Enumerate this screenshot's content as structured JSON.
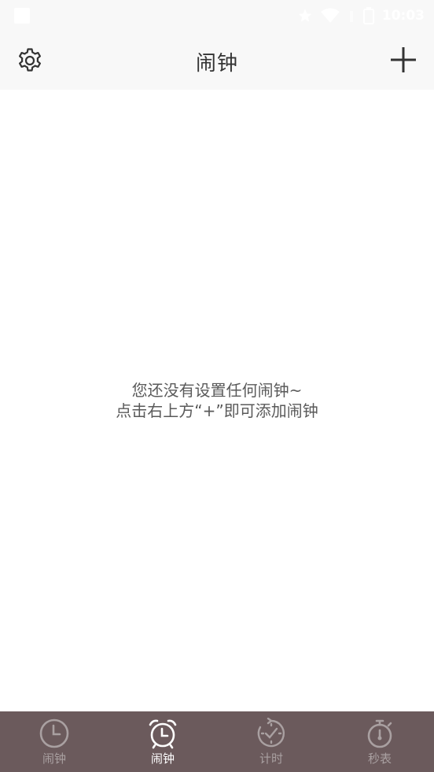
{
  "status_bar": {
    "time": "10:03"
  },
  "header": {
    "title": "闹钟"
  },
  "empty_state": {
    "line1": "您还没有设置任何闹钟~",
    "line2": "点击右上方“+”即可添加闹钟"
  },
  "bottom_nav": {
    "items": [
      {
        "label": "闹钟",
        "icon": "clock-icon",
        "active": false
      },
      {
        "label": "闹钟",
        "icon": "alarm-clock-icon",
        "active": true
      },
      {
        "label": "计时",
        "icon": "timer-icon",
        "active": false
      },
      {
        "label": "秒表",
        "icon": "stopwatch-icon",
        "active": false
      }
    ]
  },
  "colors": {
    "header_bg": "#f8f8f8",
    "nav_bg": "#6b5a5c",
    "nav_inactive": "#a9a0a1",
    "nav_active": "#ffffff",
    "text": "#5a5a5a"
  }
}
